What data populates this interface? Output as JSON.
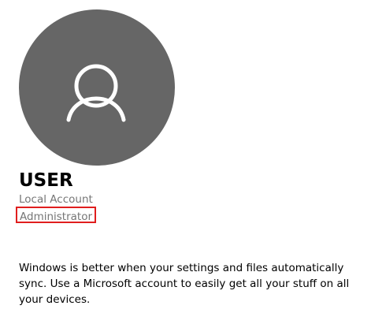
{
  "profile": {
    "name": "USER",
    "account_type": "Local Account",
    "role": "Administrator",
    "avatar_icon": "person-icon",
    "avatar_color": "#666666",
    "highlight_color": "#e01e1e"
  },
  "message": {
    "text": "Windows is better when your settings and files automatically sync. Use a Microsoft account to easily get all your stuff on all your devices."
  }
}
